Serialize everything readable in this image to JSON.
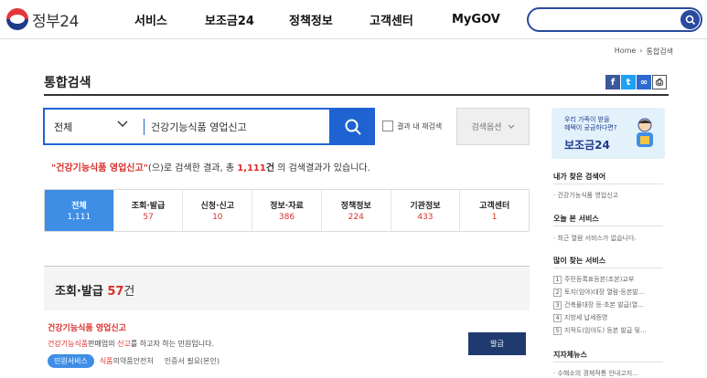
{
  "header": {
    "logo_text": "정부24",
    "nav": [
      "서비스",
      "보조금24",
      "정책정보",
      "고객센터",
      "MyGOV"
    ],
    "search_placeholder": ""
  },
  "breadcrumb": [
    "Home",
    "통합검색"
  ],
  "page_title": "통합검색",
  "search": {
    "scope": "전체",
    "query": "건강기능식품 영업신고",
    "re_search_label": "결과 내 재검색",
    "options_label": "검색옵션"
  },
  "summary": {
    "open_quote": "\"",
    "query": "건강기능식품 영업신고",
    "close_quote": "\"",
    "text1": "(으)로 검색한 결과, 총 ",
    "total": "1,111",
    "unit": "건",
    "text2": " 의 검색결과가 있습니다."
  },
  "tabs": [
    {
      "label": "전체",
      "count": "1,111"
    },
    {
      "label": "조회·발급",
      "count": "57"
    },
    {
      "label": "신청·신고",
      "count": "10"
    },
    {
      "label": "정보·자료",
      "count": "386"
    },
    {
      "label": "정책정보",
      "count": "224"
    },
    {
      "label": "기관정보",
      "count": "433"
    },
    {
      "label": "고객센터",
      "count": "1"
    }
  ],
  "section": {
    "title": "조회·발급",
    "count": "57",
    "unit": "건"
  },
  "result": {
    "title": "건강기능식품 영업신고",
    "desc_hl1": "건강기능식품",
    "desc_mid": "판매업의 ",
    "desc_hl2": "신고",
    "desc_end": "를 하고자 하는 민원입니다.",
    "badge": "민원서비스",
    "org_hl": "식품",
    "org_rest": "의약품안전처",
    "cert": "인증서 필요(본인)",
    "button": "발급"
  },
  "sidebar": {
    "banner_line1": "우리 가족이 받을",
    "banner_line2": "혜택이 궁금하다면?",
    "banner_title": "보조금24",
    "my_search_title": "내가 찾은 검색어",
    "my_search_item": "· 건강기능식품 영업신고",
    "recent_title": "오늘 본 서비스",
    "recent_item": "· 최근 열람 서비스가 없습니다.",
    "popular_title": "많이 찾는 서비스",
    "popular": [
      "주민등록표등본(초본)교부",
      "토지(임야)대장 열람·등본발...",
      "건축물대장 등·초본 발급(열...",
      "지방세 납세증명",
      "지적도(임야도) 등본 발급 및..."
    ],
    "news_title": "지자체뉴스",
    "news_item": "· 수해소의 경제적통 안내고지..."
  },
  "colors": {
    "primary_blue": "#1f63d2",
    "tab_active": "#3e8ee6",
    "highlight_red": "#d9302a",
    "navy": "#1f3a6e"
  }
}
